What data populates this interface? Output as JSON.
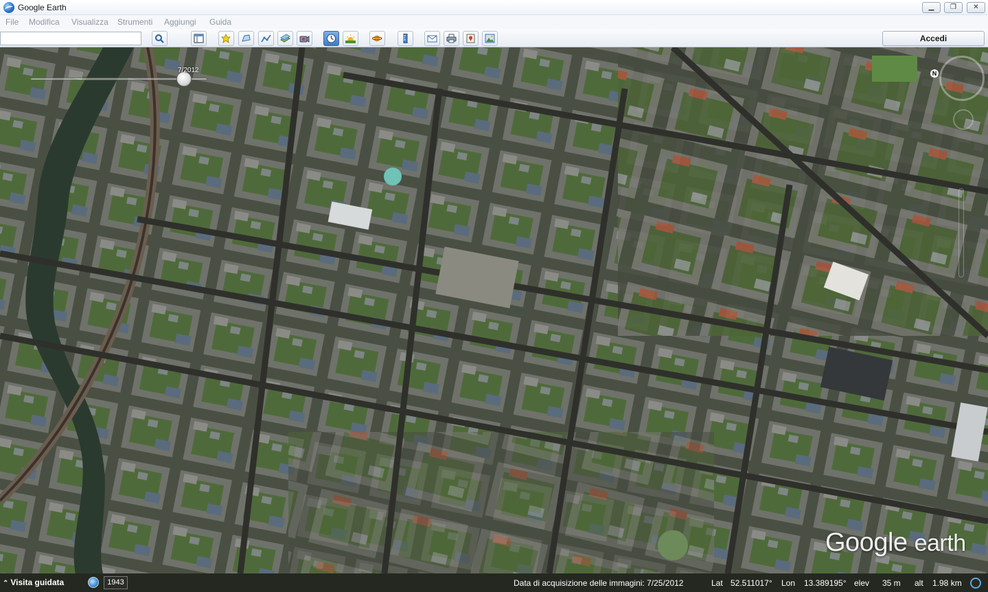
{
  "window": {
    "title": "Google Earth"
  },
  "menu": [
    "File",
    "Modifica",
    "Visualizza",
    "Strumenti",
    "Aggiungi",
    "Guida"
  ],
  "toolbar": {
    "search_value": "",
    "search_icon": "magnifier-icon",
    "signin_label": "Accedi",
    "tools": [
      {
        "name": "sidebar-toggle",
        "icon": "sidebar-icon"
      },
      {
        "name": "add-placemark",
        "icon": "pushpin-icon"
      },
      {
        "name": "add-polygon",
        "icon": "polygon-icon"
      },
      {
        "name": "add-path",
        "icon": "path-icon"
      },
      {
        "name": "add-image-overlay",
        "icon": "image-overlay-icon"
      },
      {
        "name": "record-tour",
        "icon": "camera-icon"
      },
      {
        "name": "historical-imagery",
        "icon": "clock-icon",
        "active": true
      },
      {
        "name": "sunlight",
        "icon": "sun-icon"
      },
      {
        "name": "switch-planet",
        "icon": "planet-icon"
      },
      {
        "name": "ruler",
        "icon": "ruler-icon"
      },
      {
        "name": "email",
        "icon": "envelope-icon"
      },
      {
        "name": "print",
        "icon": "printer-icon"
      },
      {
        "name": "view-in-maps",
        "icon": "map-icon"
      },
      {
        "name": "save-image",
        "icon": "save-image-icon"
      }
    ]
  },
  "map": {
    "time_slider": {
      "label": "7/2012",
      "position_fraction": 0.87
    },
    "north_label": "N",
    "watermark": {
      "google": "Google",
      "earth": "earth"
    }
  },
  "status": {
    "tour_label": "Visita guidata",
    "year": "1943",
    "imagery_date": "Data di acquisizione delle immagini: 7/25/2012",
    "lat_label": "Lat",
    "lat_value": "52.511017°",
    "lon_label": "Lon",
    "lon_value": "13.389195°",
    "elev_label": "elev",
    "elev_value": "35 m",
    "alt_label": "alt",
    "alt_value": "1.98 km"
  },
  "colors": {
    "accent": "#3f7cc0",
    "map_base": "#464d3f",
    "status_bg": "#22241e"
  }
}
